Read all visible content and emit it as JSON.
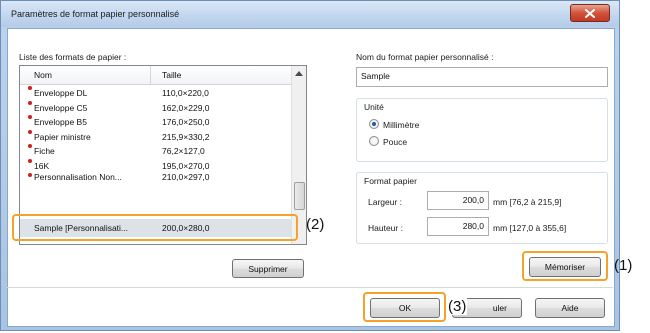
{
  "window": {
    "title": "Paramètres de format papier personnalisé"
  },
  "left": {
    "list_label": "Liste des formats de papier :",
    "columns": [
      "Nom",
      "Taille"
    ],
    "rows": [
      {
        "name": "Enveloppe DL",
        "size": "110,0×220,0"
      },
      {
        "name": "Enveloppe C5",
        "size": "162,0×229,0"
      },
      {
        "name": "Enveloppe B5",
        "size": "176,0×250,0"
      },
      {
        "name": "Papier ministre",
        "size": "215,9×330,2"
      },
      {
        "name": "Fiche",
        "size": "76,2×127,0"
      },
      {
        "name": "16K",
        "size": "195,0×270,0"
      },
      {
        "name": "Personnalisation Non...",
        "size": "210,0×297,0"
      }
    ],
    "selected_row": {
      "name": "Sample [Personnalisati...",
      "size": "200,0×280,0"
    },
    "delete_button": "Supprimer"
  },
  "right": {
    "name_label": "Nom du format papier personnalisé :",
    "name_value": "Sample",
    "unit_group": "Unité",
    "unit_options": [
      "Millimètre",
      "Pouce"
    ],
    "unit_selected": "Millimètre",
    "format_group": "Format papier",
    "width_label": "Largeur :",
    "width_value": "200,0",
    "width_range": "mm [76,2 à 215,9]",
    "height_label": "Hauteur :",
    "height_value": "280,0",
    "height_range": "mm [127,0 à 355,6]",
    "save_button": "Mémoriser"
  },
  "footer": {
    "ok_button": "OK",
    "cancel_button": "Annuler",
    "cancel_visible": "uler",
    "help_button": "Aide"
  },
  "annotations": {
    "one": "(1)",
    "two": "(2)",
    "three": "(3)"
  },
  "colors": {
    "callout": "#f5a328",
    "selection": "#dde2e8",
    "close_button": "#c03a24"
  }
}
